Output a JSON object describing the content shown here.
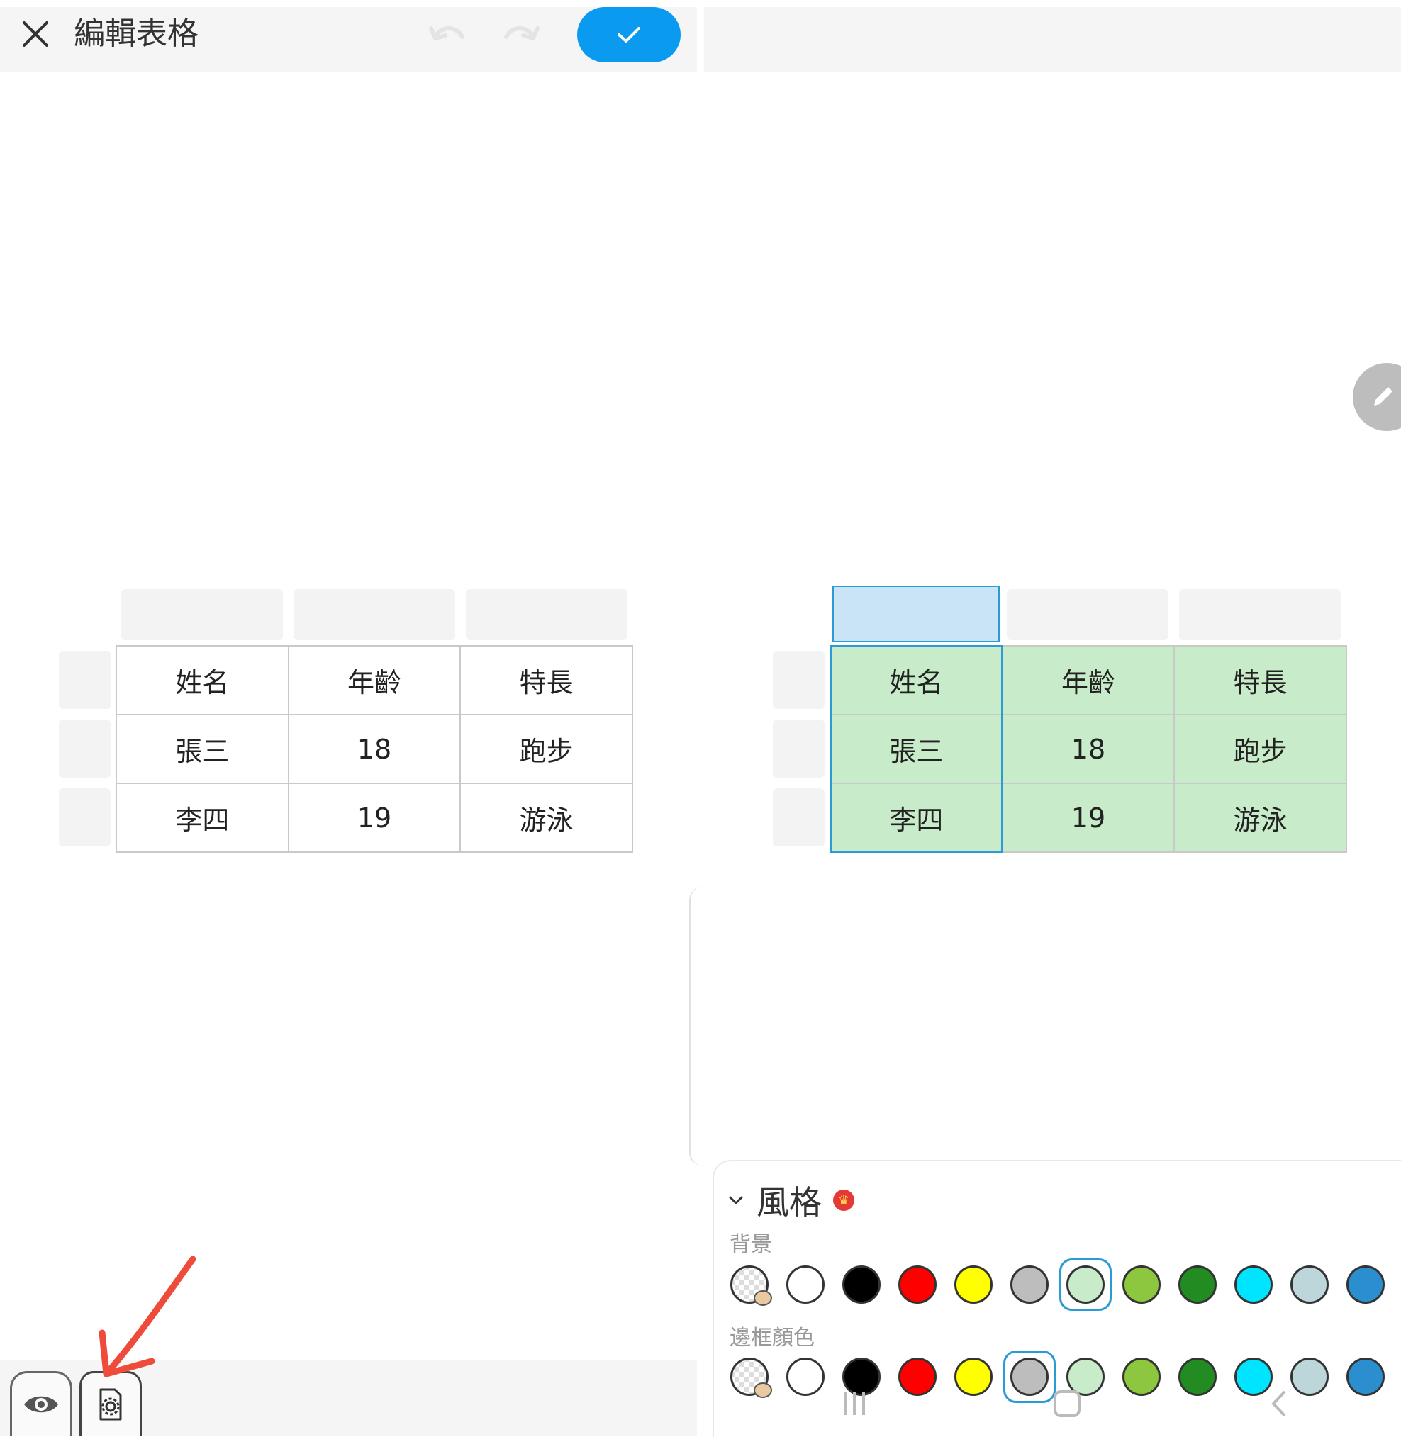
{
  "header": {
    "title": "編輯表格"
  },
  "table": {
    "rows": [
      [
        "姓名",
        "年齡",
        "特長"
      ],
      [
        "張三",
        "18",
        "跑步"
      ],
      [
        "李四",
        "19",
        "游泳"
      ]
    ]
  },
  "style_panel": {
    "title": "風格",
    "background_label": "背景",
    "border_label": "邊框顏色",
    "colors": [
      "custom",
      "#ffffff",
      "#000000",
      "#ff0000",
      "#ffff00",
      "#bdbdbd",
      "#c8ecc9",
      "#8dc63f",
      "#228b22",
      "#00e5ff",
      "#bcd6da",
      "#2b8ecf"
    ],
    "background_selected_index": 6,
    "border_selected_index": 5
  },
  "icons": {
    "close": "close-icon",
    "undo": "undo-icon",
    "redo": "redo-icon",
    "confirm": "check-icon",
    "edit": "pencil-icon",
    "preview": "eye-icon",
    "settings": "gear-document-icon",
    "annotation": "red-arrow"
  },
  "accent_color": "#0a9af0"
}
